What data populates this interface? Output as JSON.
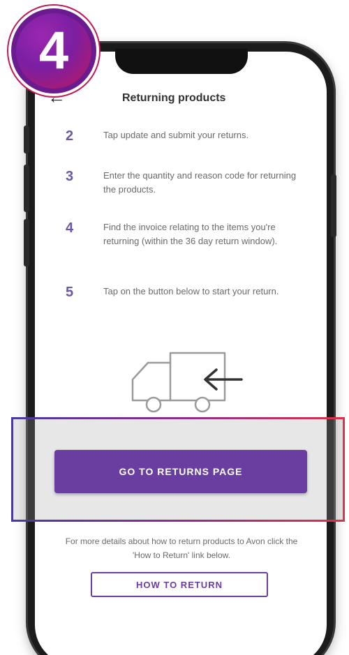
{
  "badge": {
    "step_number": "4"
  },
  "header": {
    "title": "Returning products"
  },
  "steps": [
    {
      "number": "2",
      "text": "Tap update and submit your returns."
    },
    {
      "number": "3",
      "text": "Enter the quantity and reason code for returning the products."
    },
    {
      "number": "4",
      "text": "Find the invoice relating to the items you're returning (within the 36 day return window)."
    },
    {
      "number": "5",
      "text": "Tap on the button below to start your return."
    }
  ],
  "cta": {
    "label": "GO TO RETURNS PAGE"
  },
  "info": {
    "text": "For more details about how to return products to Avon click the 'How to Return' link below."
  },
  "link": {
    "label": "HOW TO RETURN"
  },
  "colors": {
    "accent": "#6a3ea1",
    "badge_gradient_start": "#9c27b0",
    "badge_gradient_end": "#c2185b",
    "step_number": "#6b56a7"
  }
}
